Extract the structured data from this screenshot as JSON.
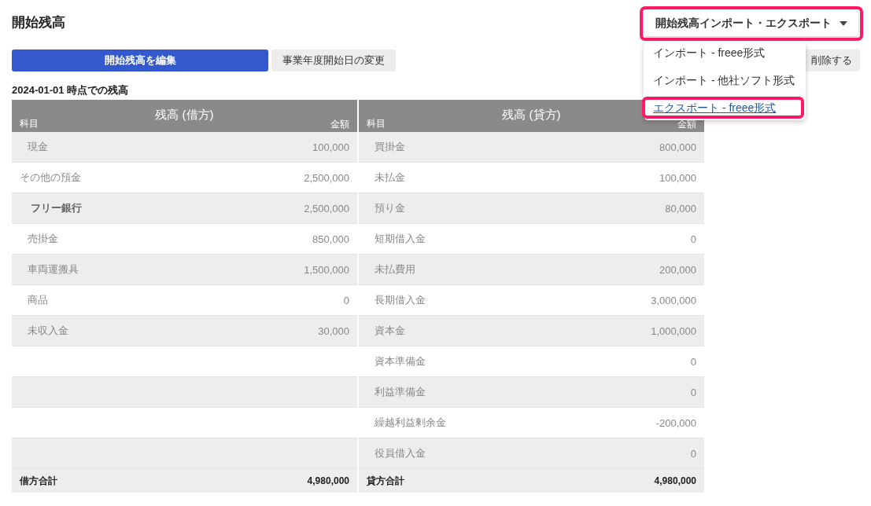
{
  "title": "開始残高",
  "io_menu": {
    "label": "開始残高インポート・エクスポート",
    "highlighted": true,
    "expanded": true,
    "items": [
      {
        "label": "インポート - freee形式",
        "highlighted": false,
        "kind": "item"
      },
      {
        "label": "インポート - 他社ソフト形式",
        "highlighted": false,
        "kind": "item"
      },
      {
        "label": "エクスポート - freee形式",
        "highlighted": true,
        "kind": "link"
      }
    ]
  },
  "buttons": [
    {
      "label": "開始残高を編集",
      "kind": "primary"
    },
    {
      "label": "事業年度開始日の変更",
      "kind": "secondary"
    }
  ],
  "delete_button": {
    "label": "削除する"
  },
  "as_of": "2024-01-01 時点での残高",
  "tables": [
    {
      "title": "残高 (借方)",
      "column_1": "科目",
      "column_2": "金額",
      "rows": [
        {
          "account": "現金",
          "amount": "100,000"
        },
        {
          "account": "その他の預金",
          "amount": "2,500,000",
          "children": [
            {
              "account": "フリー銀行",
              "amount": "2,500,000"
            }
          ]
        },
        {
          "account": "売掛金",
          "amount": "850,000"
        },
        {
          "account": "車両運搬具",
          "amount": "1,500,000"
        },
        {
          "account": "商品",
          "amount": "0"
        },
        {
          "account": "未収入金",
          "amount": "30,000"
        }
      ],
      "total_label": "借方合計",
      "total": "4,980,000"
    },
    {
      "title": "残高 (貸方)",
      "column_1": "科目",
      "column_2": "金額",
      "rows": [
        {
          "account": "買掛金",
          "amount": "800,000"
        },
        {
          "account": "未払金",
          "amount": "100,000"
        },
        {
          "account": "預り金",
          "amount": "80,000"
        },
        {
          "account": "短期借入金",
          "amount": "0"
        },
        {
          "account": "未払費用",
          "amount": "200,000"
        },
        {
          "account": "長期借入金",
          "amount": "3,000,000"
        },
        {
          "account": "資本金",
          "amount": "1,000,000"
        },
        {
          "account": "資本準備金",
          "amount": "0"
        },
        {
          "account": "利益準備金",
          "amount": "0"
        },
        {
          "account": "繰越利益剰余金",
          "amount": "-200,000"
        },
        {
          "account": "役員借入金",
          "amount": "0"
        }
      ],
      "total_label": "貸方合計",
      "total": "4,980,000"
    }
  ]
}
